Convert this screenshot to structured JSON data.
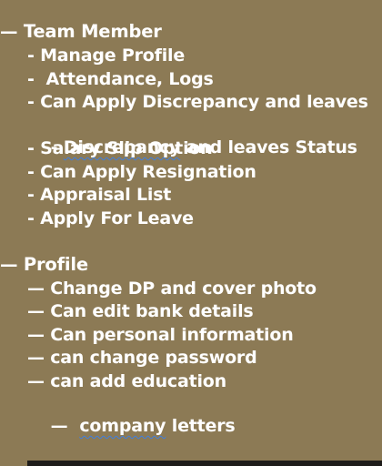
{
  "sections": [
    {
      "heading": "— Team Member",
      "items": [
        "- Manage Profile",
        "-  Attendance, Logs",
        "- Can Apply Discrepancy and leaves",
        {
          "prefix": "- ",
          "underlined": "Discrepancy",
          "rest": " and leaves Status"
        },
        "- Salary Slip Option",
        "- Can Apply Resignation",
        "- Appraisal List",
        "- Apply For Leave"
      ]
    },
    {
      "heading": "— Profile",
      "items": [
        "— Change DP and cover photo",
        "— Can edit bank details",
        "— Can personal information",
        "— can change password",
        "— can add education",
        {
          "prefix": "—  ",
          "underlined": "company",
          "rest": " letters"
        }
      ]
    }
  ]
}
